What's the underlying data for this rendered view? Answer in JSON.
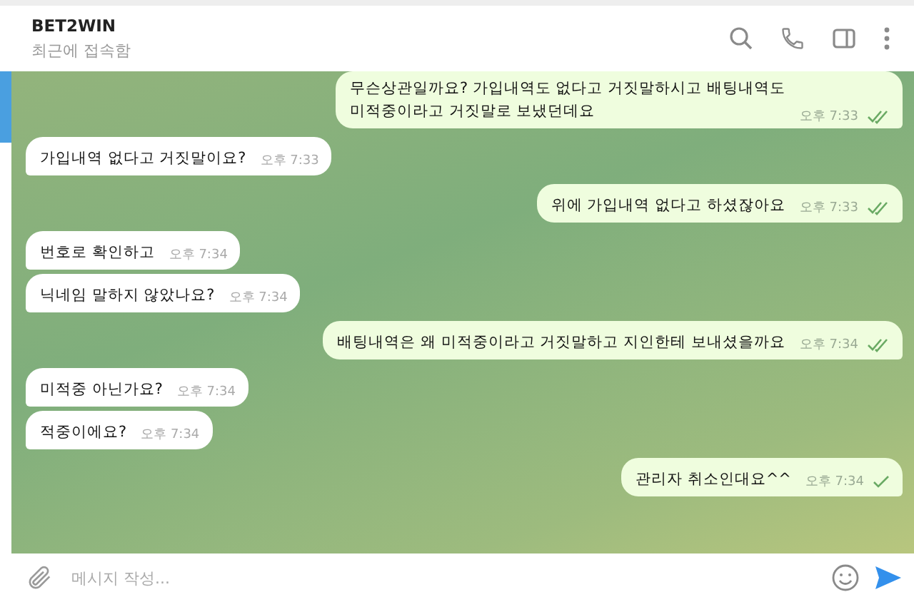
{
  "header": {
    "title": "BET2WIN",
    "status": "최근에 접속함"
  },
  "messages": [
    {
      "outgoing": true,
      "lines": [
        "무슨상관일까요? 가입내역도 없다고 거짓말하시고 배팅내역도",
        "미적중이라고 거짓말로 보냈던데요"
      ],
      "time": "오후 7:33",
      "read": true
    },
    {
      "outgoing": false,
      "lines": [
        "가입내역 없다고 거짓말이요?"
      ],
      "time": "오후 7:33"
    },
    {
      "outgoing": true,
      "lines": [
        "위에 가입내역 없다고 하셨잖아요"
      ],
      "time": "오후 7:33",
      "read": true
    },
    {
      "outgoing": false,
      "lines": [
        "번호로 확인하고"
      ],
      "time": "오후 7:34"
    },
    {
      "outgoing": false,
      "lines": [
        "닉네임 말하지 않았나요?"
      ],
      "time": "오후 7:34"
    },
    {
      "outgoing": true,
      "lines": [
        "배팅내역은 왜 미적중이라고 거짓말하고 지인한테 보내셨을까요"
      ],
      "time": "오후 7:34",
      "read": true
    },
    {
      "outgoing": false,
      "lines": [
        "미적중 아닌가요?"
      ],
      "time": "오후 7:34"
    },
    {
      "outgoing": false,
      "lines": [
        "적중이에요?"
      ],
      "time": "오후 7:34"
    },
    {
      "outgoing": true,
      "lines": [
        "관리자 취소인대요^^"
      ],
      "time": "오후 7:34",
      "read": false
    }
  ],
  "composer": {
    "placeholder": "메시지 작성..."
  }
}
